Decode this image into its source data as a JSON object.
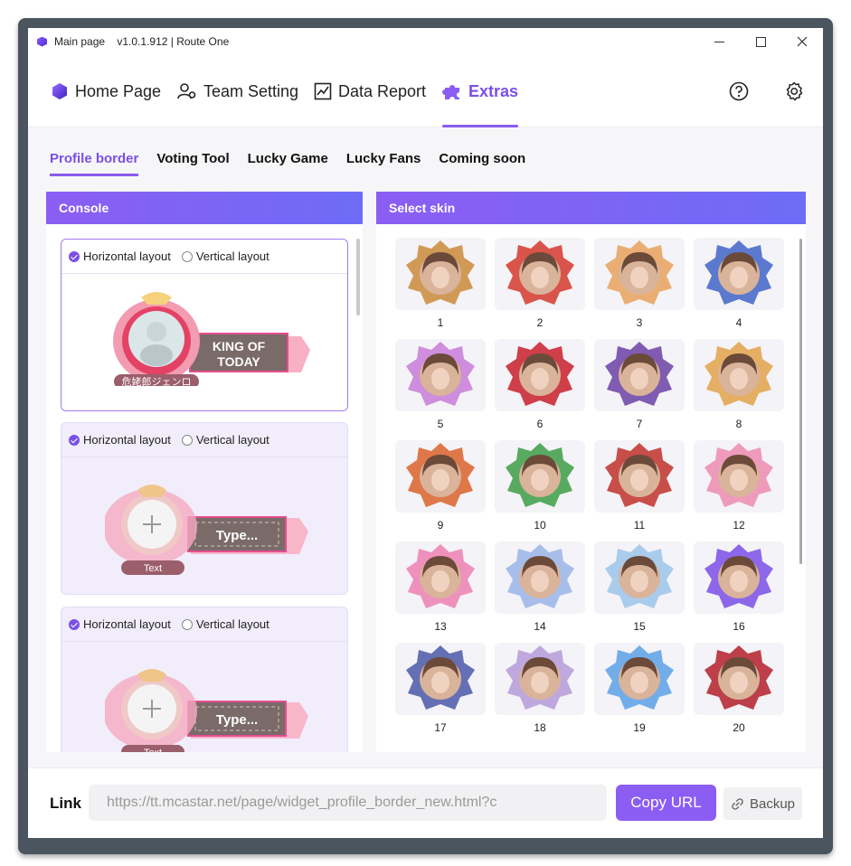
{
  "window": {
    "title": "Main page    v1.0.1.912 | Route One"
  },
  "nav": {
    "items": [
      {
        "label": "Home Page",
        "icon": "hexagon-logo-icon"
      },
      {
        "label": "Team Setting",
        "icon": "team-setting-icon"
      },
      {
        "label": "Data Report",
        "icon": "chart-report-icon"
      },
      {
        "label": "Extras",
        "icon": "puzzle-icon",
        "active": true
      }
    ],
    "right_icons": [
      "help-icon",
      "settings-gear-icon"
    ]
  },
  "subtabs": [
    {
      "label": "Profile border",
      "active": true
    },
    {
      "label": "Voting Tool"
    },
    {
      "label": "Lucky Game"
    },
    {
      "label": "Lucky Fans"
    },
    {
      "label": "Coming soon"
    }
  ],
  "console": {
    "title": "Console",
    "cards": [
      {
        "horizontal": "Horizontal layout",
        "vertical": "Vertical layout",
        "selected": true,
        "banner": "KING OF\nTODAY",
        "name": "危姥郎ジェンロ"
      },
      {
        "horizontal": "Horizontal layout",
        "vertical": "Vertical layout",
        "selected": false,
        "banner": "Type...",
        "name": "Text"
      },
      {
        "horizontal": "Horizontal layout",
        "vertical": "Vertical layout",
        "selected": false,
        "banner": "Type...",
        "name": "Text"
      }
    ]
  },
  "skins": {
    "title": "Select skin",
    "items": [
      "1",
      "2",
      "3",
      "4",
      "5",
      "6",
      "7",
      "8",
      "9",
      "10",
      "11",
      "12",
      "13",
      "14",
      "15",
      "16",
      "17",
      "18",
      "19",
      "20"
    ],
    "colors": [
      "#c98a3a",
      "#d4372c",
      "#e7a15d",
      "#3f63c8",
      "#c77ad8",
      "#c81e2c",
      "#6b3fa6",
      "#e0a24a",
      "#d9602a",
      "#3c9c45",
      "#c0302a",
      "#ec8bb0",
      "#ec7fb2",
      "#9ab4e8",
      "#9cc4ea",
      "#7a4ee8",
      "#4a57a8",
      "#b49ad8",
      "#5aa0e8",
      "#b21f2a"
    ]
  },
  "bottom": {
    "link_label": "Link",
    "link_value": "https://tt.mcastar.net/page/widget_profile_border_new.html?c",
    "copy_label": "Copy URL",
    "backup_label": "Backup"
  },
  "colors": {
    "accent": "#8c5df3",
    "accent_text": "#7b4fe8"
  }
}
